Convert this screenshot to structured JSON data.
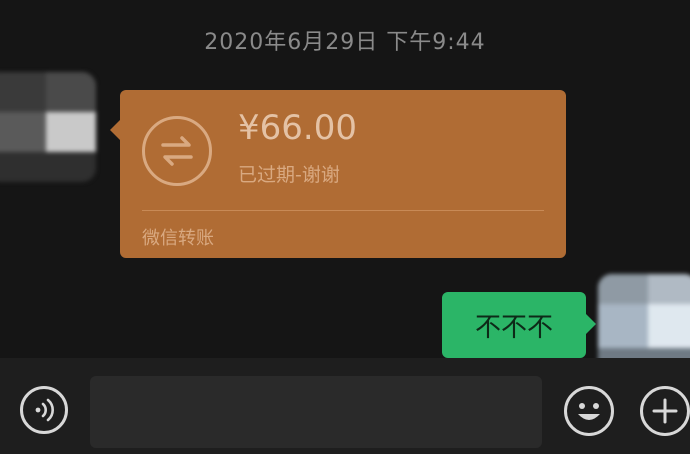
{
  "chat": {
    "timestamp": "2020年6月29日 下午9:44"
  },
  "transfer": {
    "amount": "¥66.00",
    "status": "已过期-谢谢",
    "label": "微信转账",
    "color": "#b06c34"
  },
  "sent_message": {
    "text": "不不不",
    "color": "#2bb567"
  },
  "input_bar": {
    "icons": [
      "voice-icon",
      "emoji-icon",
      "plus-icon"
    ]
  }
}
